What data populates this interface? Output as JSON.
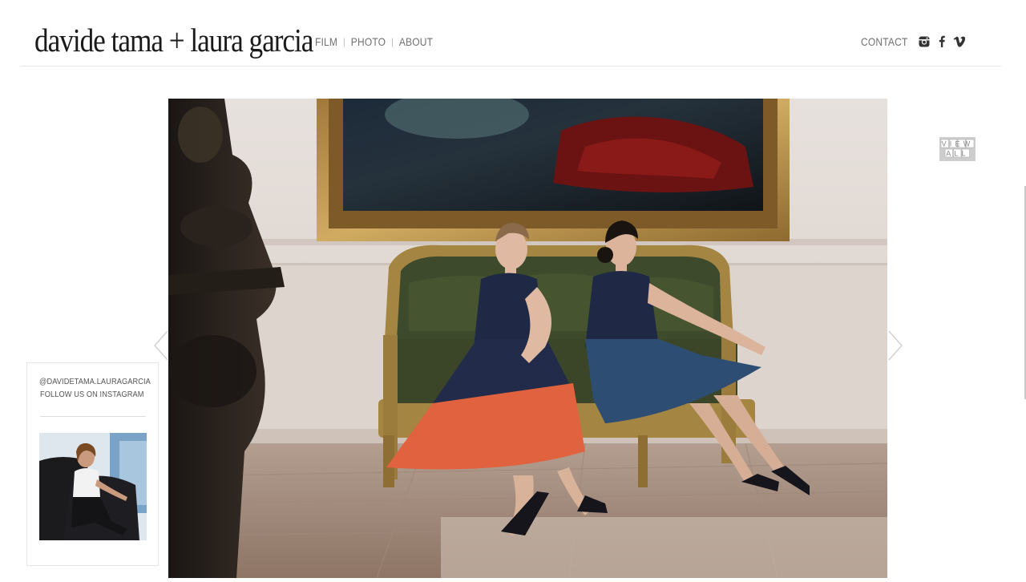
{
  "header": {
    "logo": "davide tama + laura garcia",
    "nav": [
      "FILM",
      "PHOTO",
      "ABOUT"
    ],
    "nav_separator": "|",
    "contact": "CONTACT",
    "social_icons": [
      "instagram-icon",
      "facebook-icon",
      "vimeo-icon"
    ]
  },
  "gallery": {
    "view_all_line1": "VIEW",
    "view_all_line2": "ALL",
    "prev_icon": "chevron-left-icon",
    "next_icon": "chevron-right-icon"
  },
  "instagram_widget": {
    "handle": "@DAVIDETAMA.LAURAGARCIA",
    "follow_text": "FOLLOW US ON INSTAGRAM"
  },
  "colors": {
    "logo": "#1a1a1a",
    "nav": "#707070",
    "divider": "#e8e8e8",
    "view_all_bg": "#c9c9c9"
  }
}
